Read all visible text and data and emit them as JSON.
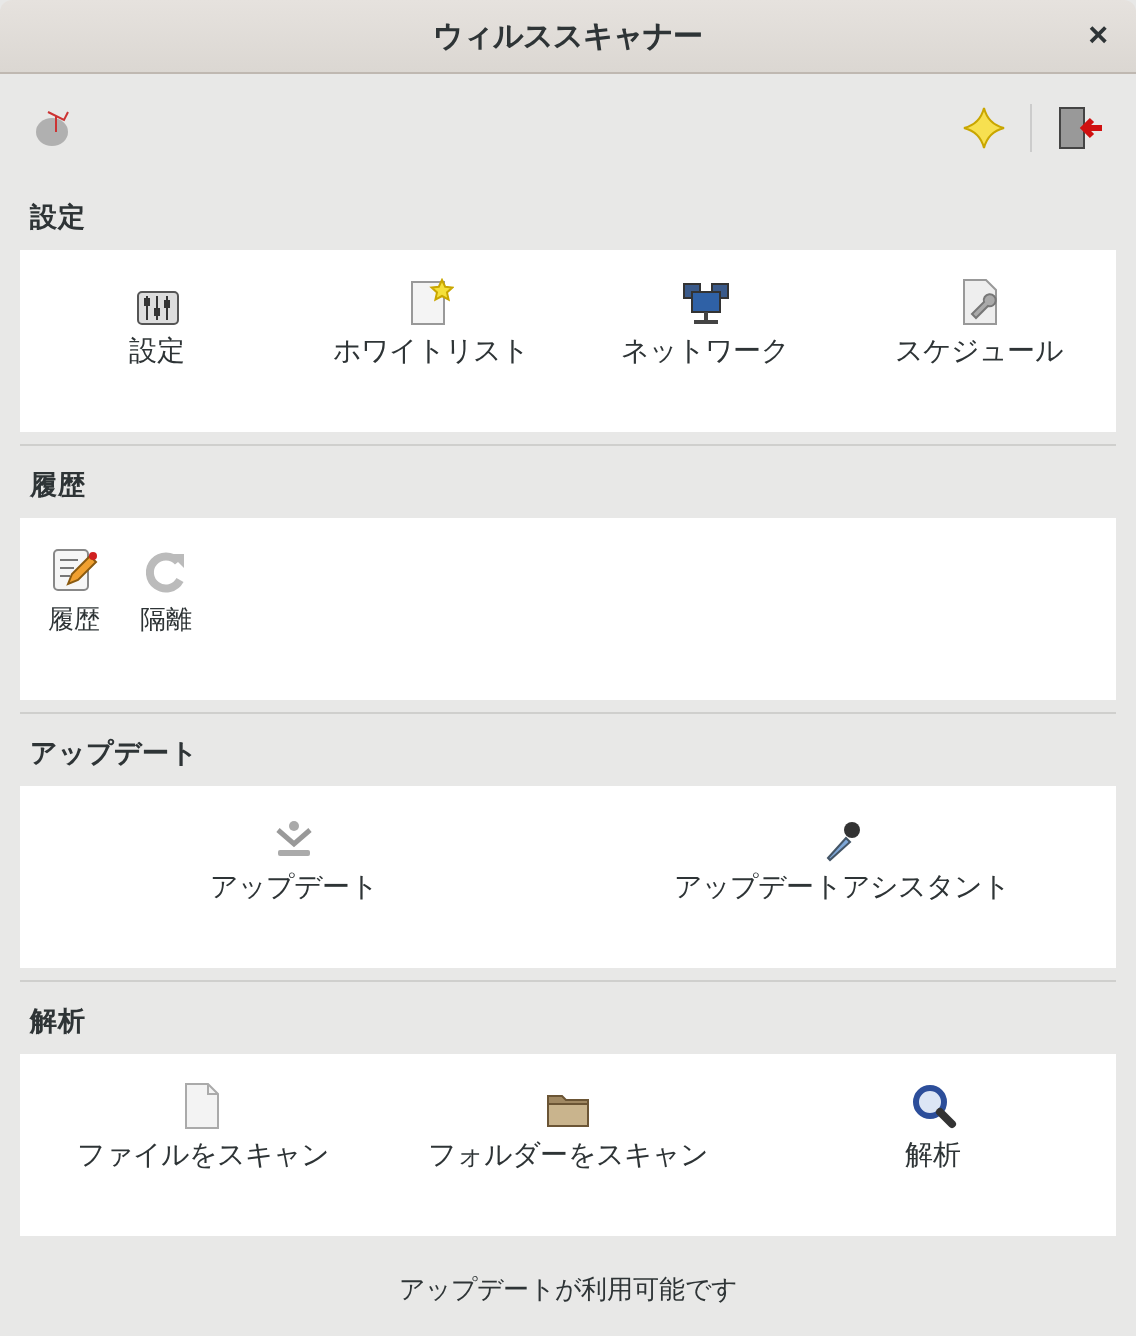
{
  "window": {
    "title": "ウィルススキャナー",
    "close": "×"
  },
  "sections": [
    {
      "title": "設定",
      "kind": "spread",
      "items": [
        {
          "label": "設定"
        },
        {
          "label": "ホワイトリスト"
        },
        {
          "label": "ネットワーク"
        },
        {
          "label": "スケジュール"
        }
      ]
    },
    {
      "title": "履歴",
      "kind": "compact",
      "items": [
        {
          "label": "履歴"
        },
        {
          "label": "隔離"
        }
      ]
    },
    {
      "title": "アップデート",
      "kind": "spread",
      "items": [
        {
          "label": "アップデート"
        },
        {
          "label": "アップデートアシスタント"
        }
      ]
    },
    {
      "title": "解析",
      "kind": "spread",
      "items": [
        {
          "label": "ファイルをスキャン"
        },
        {
          "label": "フォルダーをスキャン"
        },
        {
          "label": "解析"
        }
      ]
    }
  ],
  "status_bar": "アップデートが利用可能です"
}
